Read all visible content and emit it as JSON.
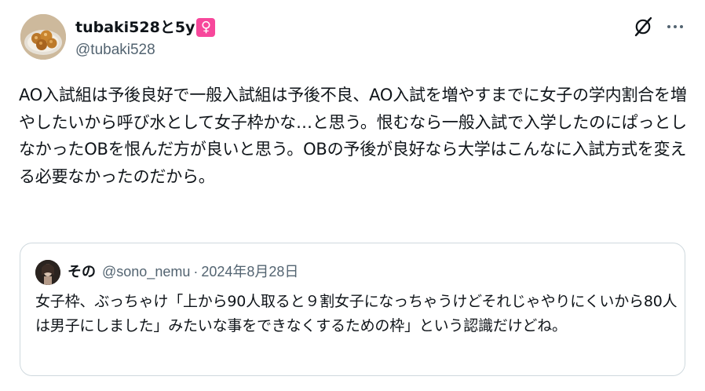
{
  "post": {
    "author": {
      "name": "tubaki528と5y",
      "badge": "♀",
      "handle": "@tubaki528",
      "badge_color": "#f7479b"
    },
    "text": "AO入試組は予後良好で一般入試組は予後不良、AO入試を増やすまでに女子の学内割合を増やしたいから呼び水として女子枠かな…と思う。恨むなら一般入試で入学したのにぱっとしなかったOBを恨んだ方が良いと思う。OBの予後が良好なら大学はこんなに入試方式を変える必要なかったのだから。",
    "actions": {
      "grok_icon": "grok-icon",
      "more_icon": "more-options-icon"
    }
  },
  "quote": {
    "name": "その",
    "handle": "@sono_nemu",
    "separator": "·",
    "date": "2024年8月28日",
    "text": "女子枠、ぶっちゃけ「上から90人取ると９割女子になっちゃうけどそれじゃやりにくいから80人は男子にしました」みたいな事をできなくするための枠」という認識だけどね。"
  },
  "colors": {
    "text_primary": "#0f1419",
    "text_secondary": "#536471",
    "border": "#cfd9de"
  }
}
